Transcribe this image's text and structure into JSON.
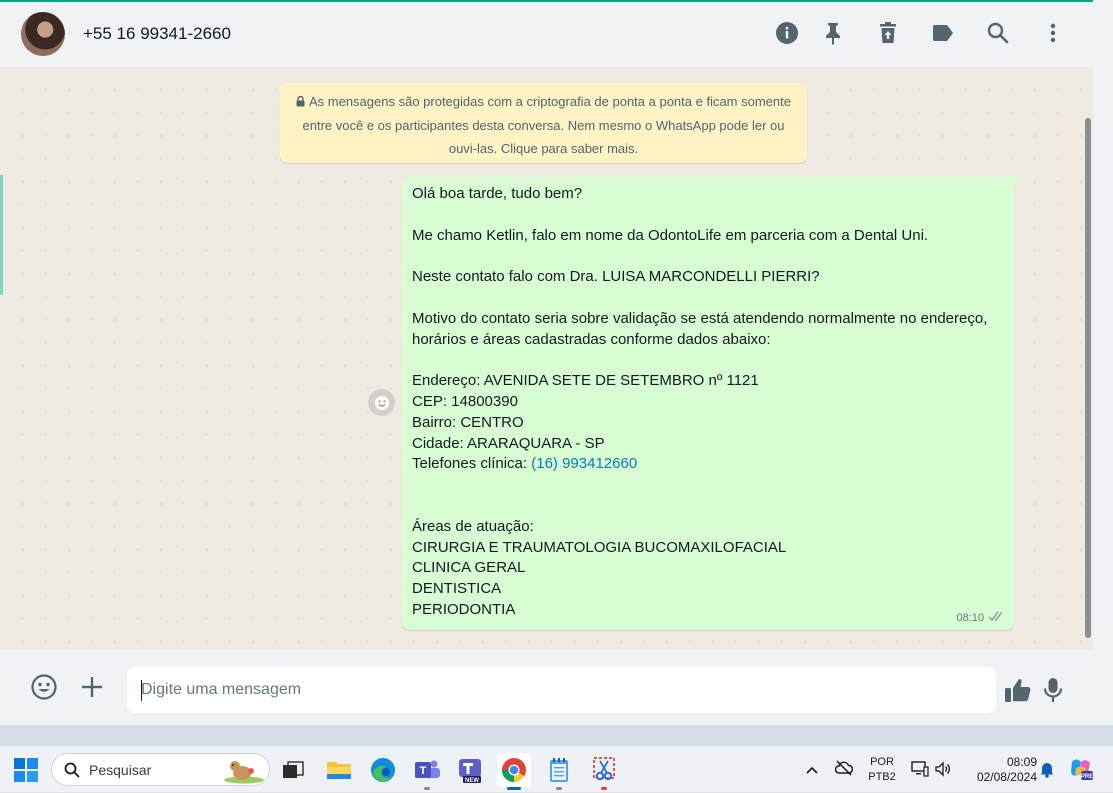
{
  "header": {
    "contact_name": "+55 16 99341-2660",
    "icons": [
      "info-icon",
      "pin-icon",
      "delete-icon",
      "label-icon",
      "search-icon",
      "menu-icon"
    ]
  },
  "encryption_notice": {
    "text": "As mensagens são protegidas com a criptografia de ponta a ponta e ficam somente entre você e os participantes desta conversa. Nem mesmo o WhatsApp pode ler ou ouvi-las. Clique para saber mais."
  },
  "message": {
    "lines": [
      "Olá boa tarde, tudo bem?",
      "",
      "Me chamo Ketlin, falo em nome da OdontoLife em parceria com a Dental Uni.",
      "",
      "Neste contato falo com Dra. LUISA MARCONDELLI PIERRI?",
      "",
      "Motivo do contato seria sobre validação se está atendendo normalmente no endereço, horários e áreas cadastradas conforme dados abaixo:",
      "",
      "Endereço: AVENIDA SETE DE SETEMBRO nº 1121",
      "CEP: 14800390",
      "Bairro: CENTRO",
      "Cidade: ARARAQUARA - SP"
    ],
    "phone_label": "Telefones clínica: ",
    "phone_link": "(16) 993412660",
    "lines_after": [
      "",
      "",
      "Áreas de atuação:",
      "CIRURGIA E TRAUMATOLOGIA BUCOMAXILOFACIAL",
      "CLINICA GERAL",
      "DENTISTICA",
      "PERIODONTIA"
    ],
    "time": "08:10",
    "status": "delivered"
  },
  "composer": {
    "placeholder": "Digite uma mensagem"
  },
  "taskbar": {
    "search_label": "Pesquisar",
    "apps": [
      "task-view",
      "file-explorer",
      "edge",
      "teams",
      "teams-new",
      "chrome",
      "notepad",
      "snipping-tool"
    ],
    "lang_top": "POR",
    "lang_bottom": "PTB2",
    "time": "08:09",
    "date": "02/08/2024"
  },
  "colors": {
    "accent": "#00a884",
    "bubble_out": "#d9fdd3",
    "notice_bg": "#fdf3c5",
    "link": "#027eb5"
  }
}
